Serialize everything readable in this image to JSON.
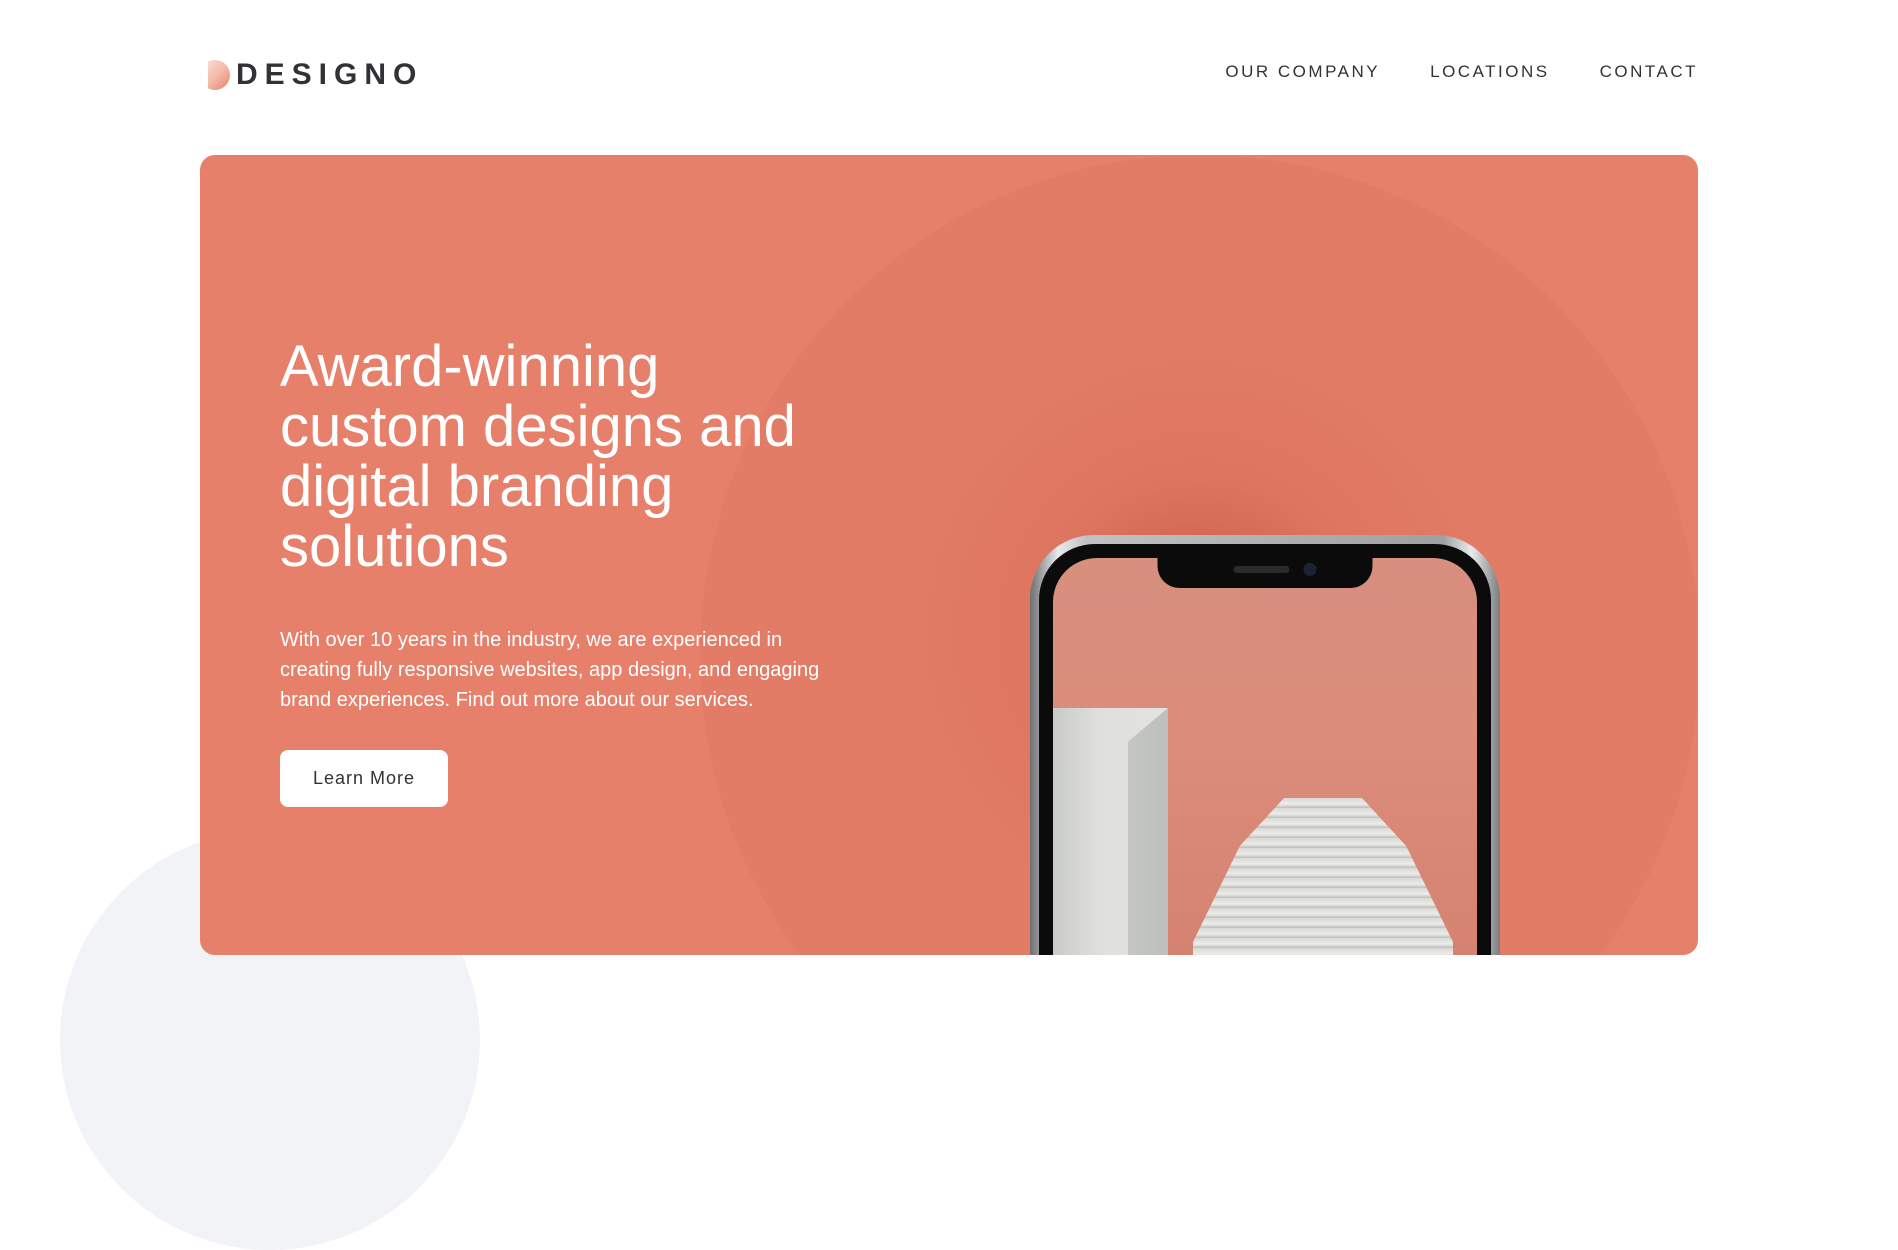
{
  "header": {
    "logo_text": "DESIGNO",
    "nav": [
      "OUR COMPANY",
      "LOCATIONS",
      "CONTACT"
    ]
  },
  "hero": {
    "title": "Award-winning custom designs and digital branding solutions",
    "description": "With over 10 years in the industry, we are experienced in creating fully responsive websites, app design, and engaging brand experiences. Find out more about our services.",
    "button_label": "Learn More"
  },
  "colors": {
    "accent": "#e7806a",
    "text_dark": "#333136",
    "background": "#ffffff"
  }
}
